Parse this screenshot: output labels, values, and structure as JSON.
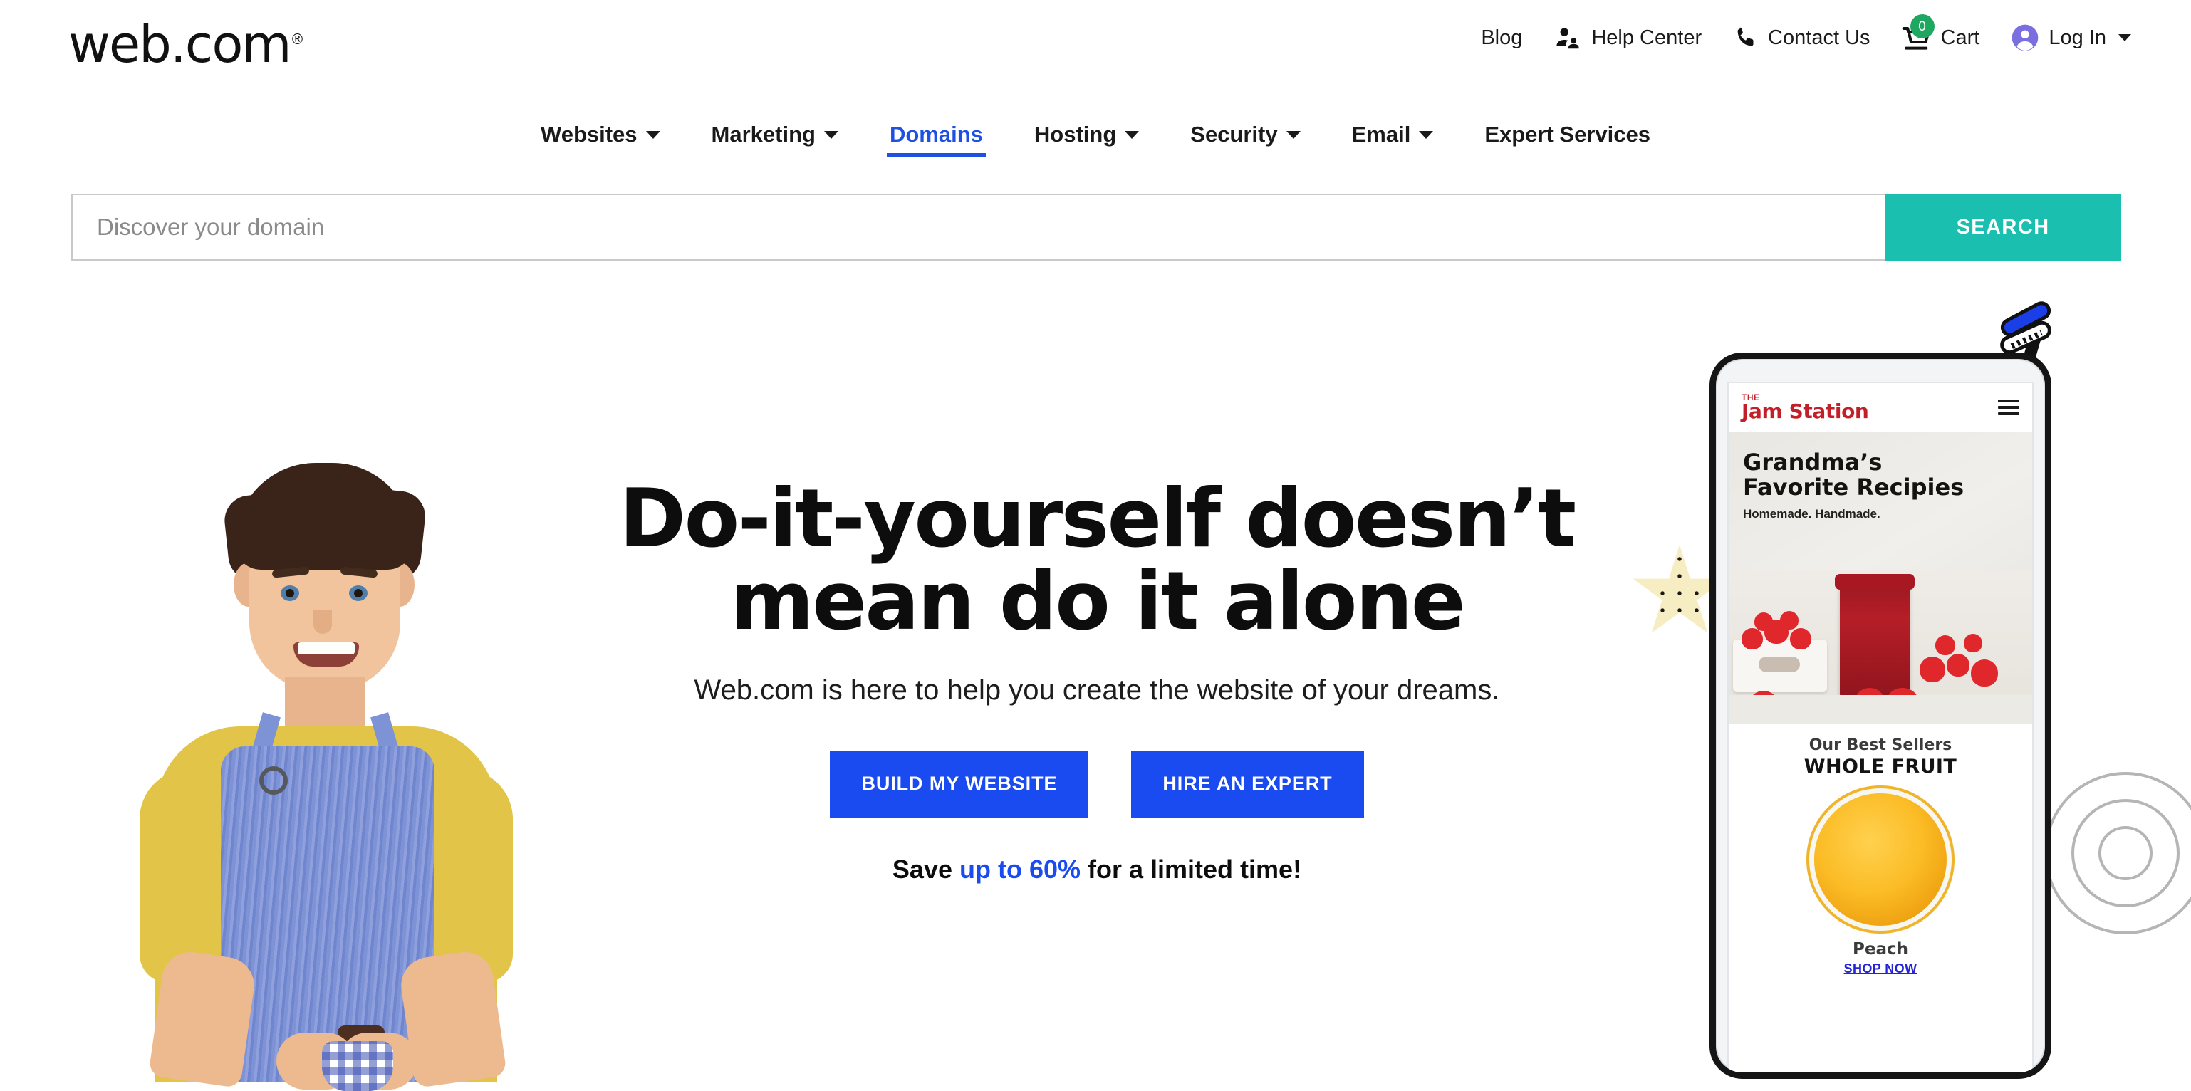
{
  "brand": {
    "logo_text": "web.com",
    "logo_registered": "®",
    "accent_blue": "#1A4BF0",
    "accent_teal": "#1BBFAF",
    "nav_active_blue": "#1E50E2",
    "cart_badge_green": "#1EA760",
    "login_avatar_purple": "#7B6FE0"
  },
  "utility_nav": {
    "items": [
      {
        "label": "Blog",
        "icon": "none"
      },
      {
        "label": "Help Center",
        "icon": "support-agent-icon"
      },
      {
        "label": "Contact Us",
        "icon": "phone-icon"
      },
      {
        "label": "Cart",
        "icon": "shopping-cart-icon",
        "badge": "0"
      },
      {
        "label": "Log In",
        "icon": "account-circle-icon",
        "has_caret": true
      }
    ]
  },
  "main_nav": {
    "items": [
      {
        "label": "Websites",
        "has_caret": true,
        "active": false
      },
      {
        "label": "Marketing",
        "has_caret": true,
        "active": false
      },
      {
        "label": "Domains",
        "has_caret": false,
        "active": true
      },
      {
        "label": "Hosting",
        "has_caret": true,
        "active": false
      },
      {
        "label": "Security",
        "has_caret": true,
        "active": false
      },
      {
        "label": "Email",
        "has_caret": true,
        "active": false
      },
      {
        "label": "Expert Services",
        "has_caret": false,
        "active": false
      }
    ]
  },
  "search": {
    "placeholder": "Discover your domain",
    "value": "",
    "button_label": "SEARCH"
  },
  "hero": {
    "title_line1": "Do-it-yourself doesn’t",
    "title_line2": "mean do it alone",
    "subtitle": "Web.com is here to help you create the website of your dreams.",
    "cta_primary": "BUILD MY WEBSITE",
    "cta_secondary": "HIRE AN EXPERT",
    "promo_prefix": "Save ",
    "promo_highlight": "up to 60%",
    "promo_suffix": " for a limited time!",
    "image_alt": "smiling-man-in-yellow-shirt-and-blue-apron-holding-jam-jar"
  },
  "phone_mockup": {
    "site_logo_the": "THE",
    "site_logo_name": "Jam Station",
    "menu_icon": "hamburger-menu-icon",
    "hero_heading_line1": "Grandma’s",
    "hero_heading_line2": "Favorite Recipies",
    "hero_tagline": "Homemade. Handmade.",
    "hero_image_alt": "strawberries-and-jar-of-strawberry-jam",
    "best_sellers_label": "Our Best Sellers",
    "best_sellers_title": "WHOLE FRUIT",
    "product_image_alt": "jar-of-peach-jam-top-view",
    "product_name": "Peach",
    "product_link": "SHOP NOW"
  },
  "decorations": {
    "star_alt": "hand-drawn-polka-dot-star",
    "burst_alt": "hand-drawn-burst-marks",
    "rings_alt": "concentric-gray-circles"
  }
}
